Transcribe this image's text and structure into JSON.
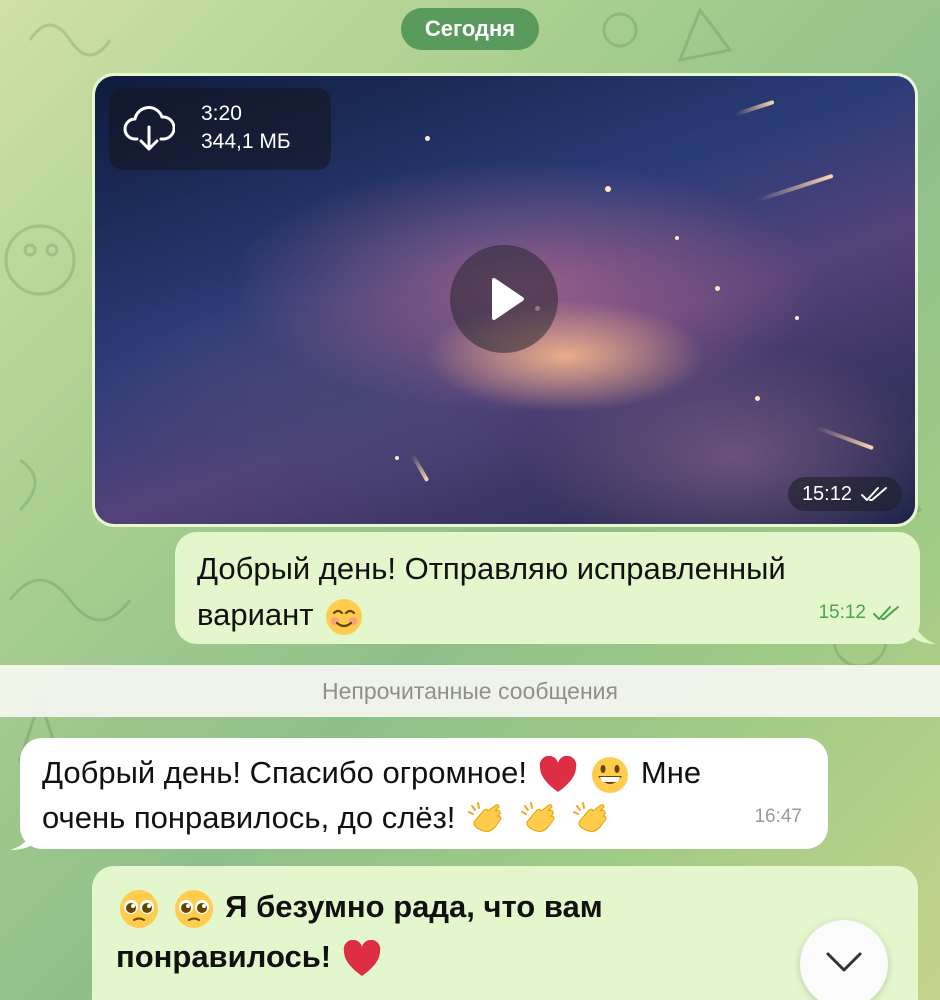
{
  "date_separator": "Сегодня",
  "video_message": {
    "duration": "3:20",
    "size": "344,1 МБ",
    "time": "15:12"
  },
  "messages": [
    {
      "direction": "outgoing",
      "line1": "Добрый день! Отправляю исправленный",
      "line2": "вариант",
      "emoji": [
        "smiling-face-icon"
      ],
      "time": "15:12",
      "status": "read"
    },
    {
      "direction": "incoming",
      "line1_text": "Добрый день! Спасибо огромное!",
      "line1_tail": "Мне",
      "line2": "очень понравилось, до слёз!",
      "emoji": [
        "red-heart-icon",
        "grinning-face-icon",
        "clapping-hands-icon",
        "clapping-hands-icon",
        "clapping-hands-icon"
      ],
      "time": "16:47"
    }
  ],
  "unread_separator": "Непрочитанные сообщения",
  "draft": {
    "line1": "Я безумно рада, что вам",
    "line2": "понравилось!",
    "emoji": [
      "pleading-face-icon",
      "pleading-face-icon",
      "red-heart-icon"
    ]
  },
  "colors": {
    "date_pill": "#5a9a5c",
    "outgoing_bubble": "#e4f7cc",
    "incoming_bubble": "#ffffff",
    "read_checks": "#4aa54a"
  }
}
